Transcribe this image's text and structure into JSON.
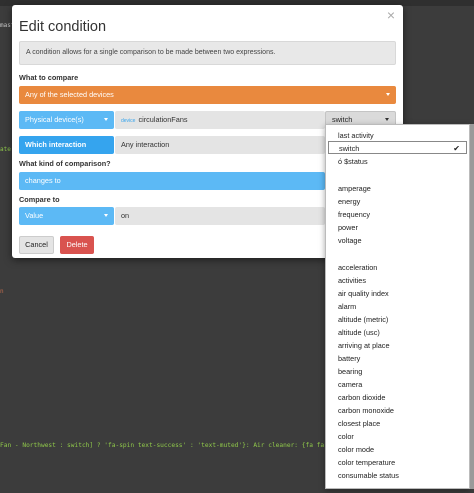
{
  "background": {
    "frag_1": "mast",
    "frag_2": "ate",
    "frag_3": "n",
    "frag_4": "Fan - Northwest : switch] ? 'fa-spin text-success' : 'text-muted'}: Air cleaner: {fa fa-"
  },
  "modal": {
    "title": "Edit condition",
    "close_glyph": "×",
    "description": "A condition allows for a single comparison to be made between two expressions.",
    "what_to_compare": {
      "label": "What to compare",
      "scope_select": "Any of the selected devices",
      "source_select": "Physical device(s)",
      "device_tag": "device",
      "device_name": "circulationFans",
      "attribute_select": "switch"
    },
    "interaction": {
      "button_label": "Which interaction",
      "value": "Any interaction"
    },
    "comparison": {
      "label": "What kind of comparison?",
      "select": "changes to"
    },
    "compare_to": {
      "label": "Compare to",
      "type_select": "Value",
      "value": "on"
    },
    "cancel_label": "Cancel",
    "delete_label": "Delete"
  },
  "dropdown": {
    "check_glyph": "✔",
    "items": [
      "last activity",
      "switch",
      "ó $status",
      "amperage",
      "energy",
      "frequency",
      "power",
      "voltage",
      "acceleration",
      "activities",
      "air quality index",
      "alarm",
      "altitude (metric)",
      "altitude (usc)",
      "arriving at place",
      "battery",
      "bearing",
      "camera",
      "carbon dioxide",
      "carbon monoxide",
      "closest place",
      "color",
      "color mode",
      "color temperature",
      "consumable status"
    ]
  }
}
